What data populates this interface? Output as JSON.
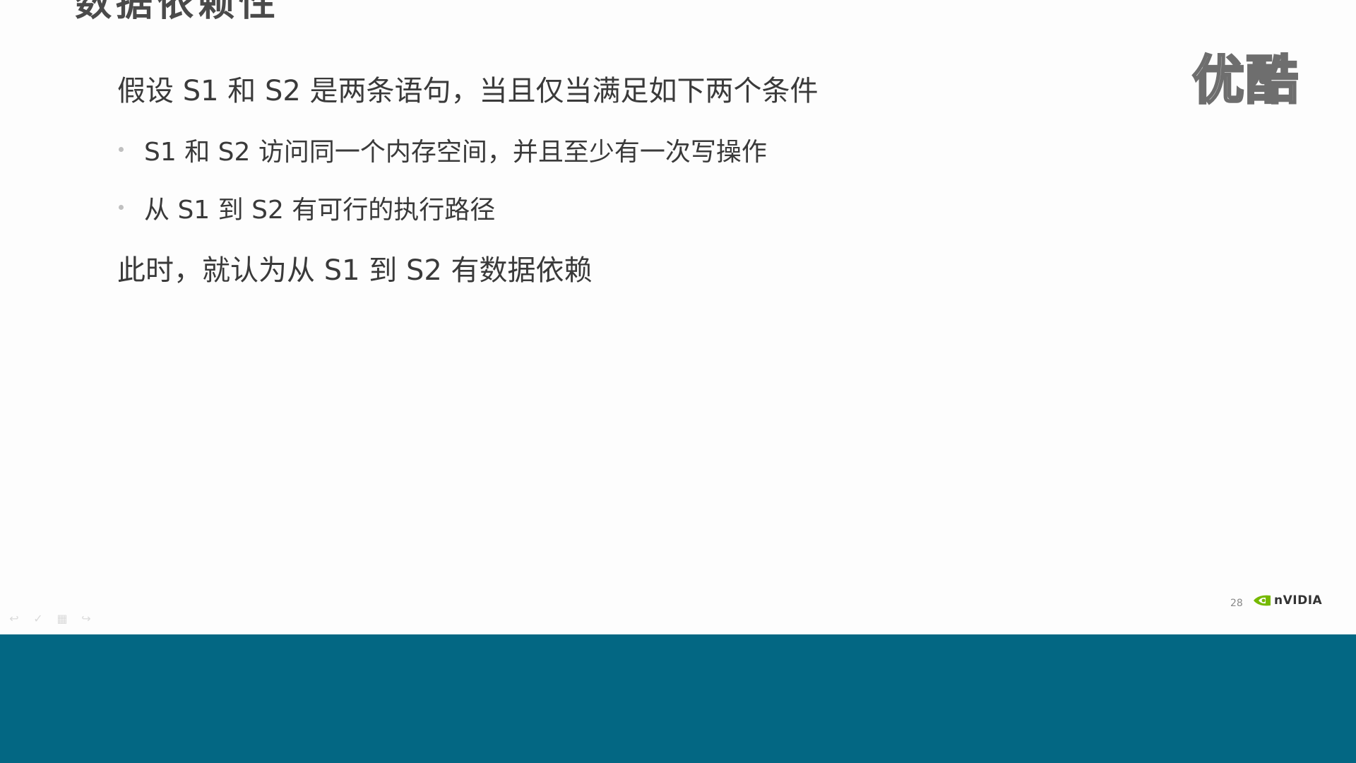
{
  "slide": {
    "title": "数据依赖性",
    "intro": "假设 S1 和 S2 是两条语句，当且仅当满足如下两个条件",
    "bullets": [
      {
        "text": "S1 和 S2 访问同一个内存空间，并且至少有一次写操作"
      },
      {
        "text": "从 S1 到 S2 有可行的执行路径"
      }
    ],
    "conclusion": "此时，就认为从 S1 到 S2 有数据依赖",
    "page_number": "28",
    "logo_text": "nVIDIA"
  },
  "watermark": {
    "text": "优酷"
  },
  "nav_controls": [
    {
      "icon": "previous-icon",
      "glyph": "↩"
    },
    {
      "icon": "pen-icon",
      "glyph": "✓"
    },
    {
      "icon": "slides-icon",
      "glyph": "▦"
    },
    {
      "icon": "next-icon",
      "glyph": "↪"
    }
  ],
  "colors": {
    "footer_band": "#036783",
    "text": "#3a3a3a",
    "logo_green": "#76b900"
  }
}
